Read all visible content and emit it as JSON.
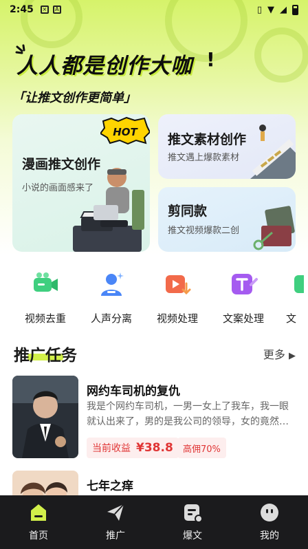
{
  "status_bar": {
    "time": "2:45"
  },
  "hero": {
    "slogan": "人人都是创作大咖",
    "slogan_mark": "!",
    "subslogan": "「让推文创作更简单」"
  },
  "cards": {
    "big": {
      "title": "漫画推文创作",
      "subtitle": "小说的画面感来了",
      "badge": "HOT"
    },
    "top": {
      "title": "推文素材创作",
      "subtitle": "推文遇上爆款素材"
    },
    "bottom": {
      "title": "剪同款",
      "subtitle": "推文视频爆款二创"
    }
  },
  "tools": [
    {
      "label": "视频去重",
      "icon": "video-camera-icon",
      "color": "#3fcf7f"
    },
    {
      "label": "人声分离",
      "icon": "voice-person-icon",
      "color": "#4a86f7"
    },
    {
      "label": "视频处理",
      "icon": "video-play-icon",
      "color": "#f26a4a"
    },
    {
      "label": "文案处理",
      "icon": "text-edit-icon",
      "color": "#a55bf0"
    },
    {
      "label": "文",
      "icon": "more-tool-icon",
      "color": "#3fcf7f"
    }
  ],
  "section": {
    "title": "推广任务",
    "more": "更多"
  },
  "tasks": [
    {
      "title": "网约车司机的复仇",
      "desc": "我是个网约车司机，一男一女上了我车，我一眼就认出来了，男的是我公司的领导，女的竟然…",
      "earn_label": "当前收益",
      "earn_amount": "¥38.8",
      "commission": "高佣70%"
    },
    {
      "title": "七年之痒"
    }
  ],
  "tabbar": [
    {
      "label": "首页",
      "icon": "home-icon",
      "active": true
    },
    {
      "label": "推广",
      "icon": "send-icon",
      "active": false
    },
    {
      "label": "爆文",
      "icon": "hot-article-icon",
      "active": false
    },
    {
      "label": "我的",
      "icon": "profile-icon",
      "active": false
    }
  ],
  "colors": {
    "accent": "#d2f04a",
    "dark_bar": "#1b1b1d",
    "earn_red": "#e03535"
  }
}
